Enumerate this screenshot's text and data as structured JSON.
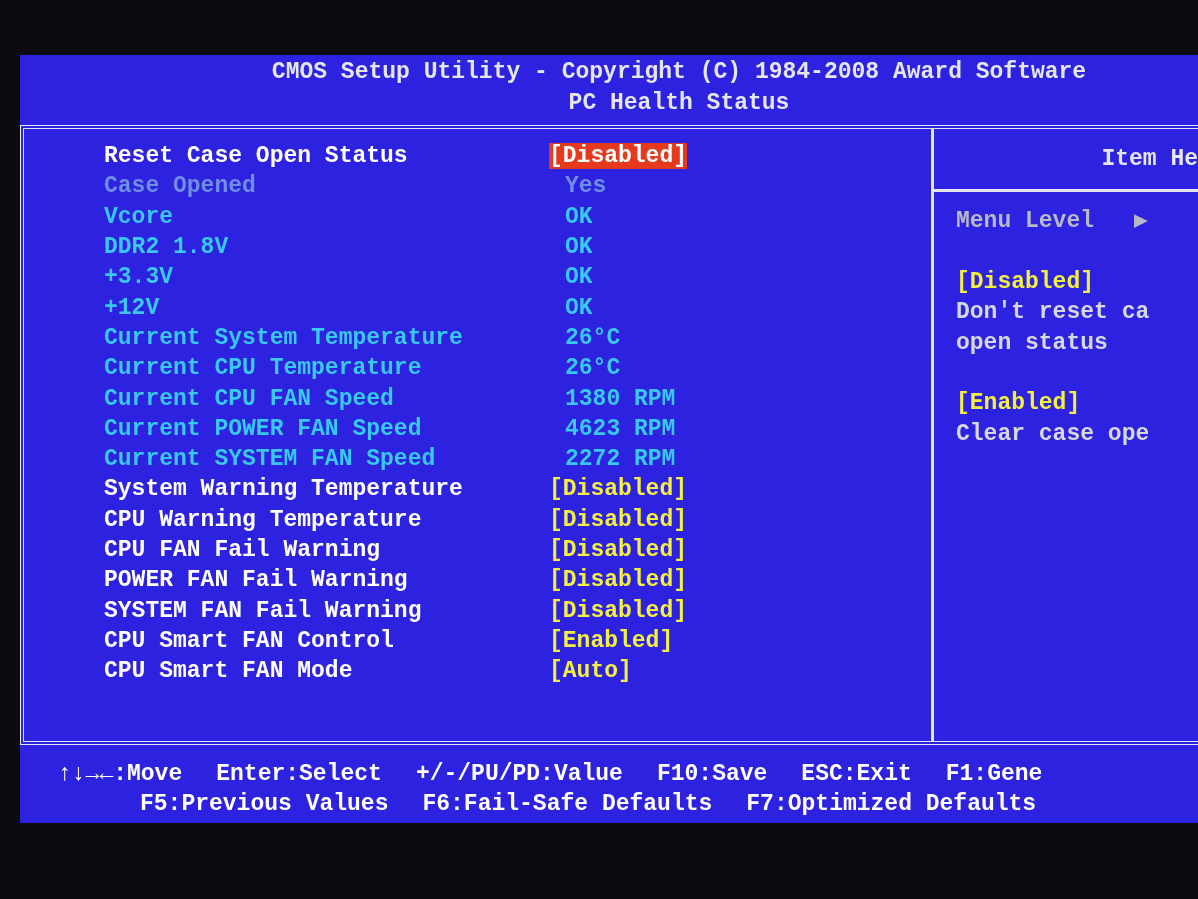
{
  "header": {
    "title": "CMOS Setup Utility - Copyright (C) 1984-2008 Award Software",
    "subtitle": "PC Health Status"
  },
  "items": [
    {
      "kind": "option",
      "label": "Reset Case Open Status",
      "value": "[Disabled]",
      "selected": true
    },
    {
      "kind": "greyed",
      "label": "Case Opened",
      "value": "Yes"
    },
    {
      "kind": "reading",
      "label": "Vcore",
      "value": "OK"
    },
    {
      "kind": "reading",
      "label": "DDR2 1.8V",
      "value": "OK"
    },
    {
      "kind": "reading",
      "label": "+3.3V",
      "value": "OK"
    },
    {
      "kind": "reading",
      "label": "+12V",
      "value": "OK"
    },
    {
      "kind": "reading",
      "label": "Current System Temperature",
      "value": "26°C"
    },
    {
      "kind": "reading",
      "label": "Current CPU Temperature",
      "value": "26°C"
    },
    {
      "kind": "reading",
      "label": "Current CPU FAN Speed",
      "value": "1380 RPM"
    },
    {
      "kind": "reading",
      "label": "Current POWER FAN Speed",
      "value": "4623 RPM"
    },
    {
      "kind": "reading",
      "label": "Current SYSTEM FAN Speed",
      "value": "2272 RPM"
    },
    {
      "kind": "option",
      "label": "System Warning Temperature",
      "value": "[Disabled]",
      "selected": false
    },
    {
      "kind": "option",
      "label": "CPU Warning Temperature",
      "value": "[Disabled]",
      "selected": false
    },
    {
      "kind": "option",
      "label": "CPU FAN Fail Warning",
      "value": "[Disabled]",
      "selected": false
    },
    {
      "kind": "option",
      "label": "POWER FAN Fail Warning",
      "value": "[Disabled]",
      "selected": false
    },
    {
      "kind": "option",
      "label": "SYSTEM FAN Fail Warning",
      "value": "[Disabled]",
      "selected": false
    },
    {
      "kind": "option",
      "label": "CPU Smart FAN Control",
      "value": "[Enabled]",
      "selected": false
    },
    {
      "kind": "option",
      "label": "CPU Smart FAN Mode",
      "value": "[Auto]",
      "selected": false
    }
  ],
  "help": {
    "title": "Item He",
    "menu_level": "Menu Level",
    "menu_level_marker": "▶",
    "entries": [
      {
        "option": "[Disabled]",
        "lines": [
          "Don't reset ca",
          "open status"
        ]
      },
      {
        "option": "[Enabled]",
        "lines": [
          "Clear case ope"
        ]
      }
    ]
  },
  "footer": {
    "upper_line": [
      {
        "key": "↑↓→←",
        "action": ":Move"
      },
      {
        "key": "Enter",
        "action": ":Select"
      },
      {
        "key": "+/-/PU/PD",
        "action": ":Value"
      },
      {
        "key": "F10",
        "action": ":Save"
      },
      {
        "key": "ESC",
        "action": ":Exit"
      },
      {
        "key": "F1",
        "action": ":Gene"
      }
    ],
    "lower_line": [
      {
        "key": "F5",
        "action": ":Previous Values"
      },
      {
        "key": "F6",
        "action": ":Fail-Safe Defaults"
      },
      {
        "key": "F7",
        "action": ":Optimized Defaults"
      }
    ]
  }
}
